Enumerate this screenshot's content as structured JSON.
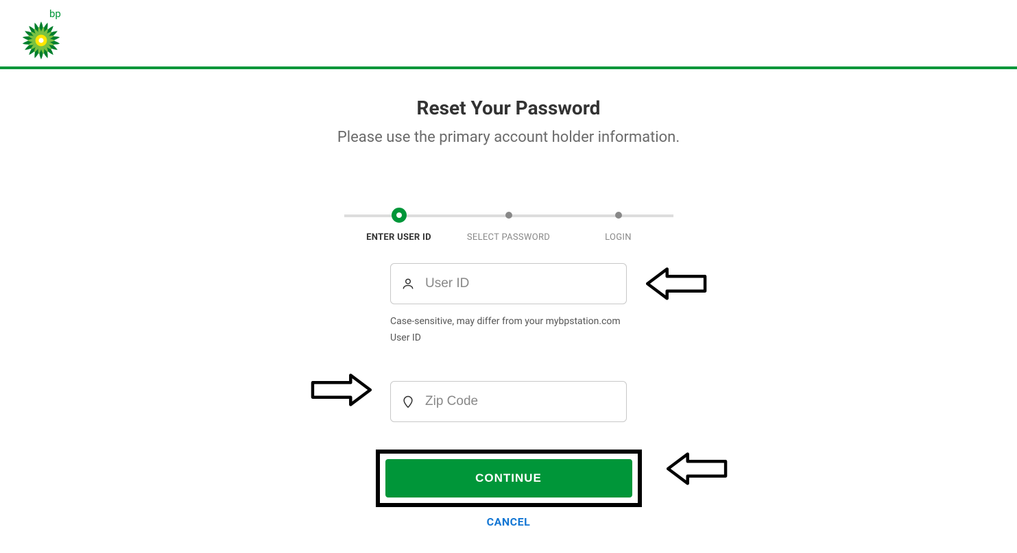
{
  "brand": {
    "name": "bp"
  },
  "page": {
    "title": "Reset Your Password",
    "subtitle": "Please use the primary account holder information."
  },
  "stepper": {
    "steps": [
      {
        "label": "ENTER USER ID",
        "active": true
      },
      {
        "label": "SELECT PASSWORD",
        "active": false
      },
      {
        "label": "LOGIN",
        "active": false
      }
    ]
  },
  "form": {
    "user_id": {
      "placeholder": "User ID",
      "value": ""
    },
    "user_id_hint": "Case-sensitive, may differ from your mybpstation.com User ID",
    "zip": {
      "placeholder": "Zip Code",
      "value": ""
    }
  },
  "actions": {
    "continue_label": "CONTINUE",
    "cancel_label": "CANCEL"
  },
  "colors": {
    "brand_green": "#009639",
    "link_blue": "#1276d4"
  }
}
